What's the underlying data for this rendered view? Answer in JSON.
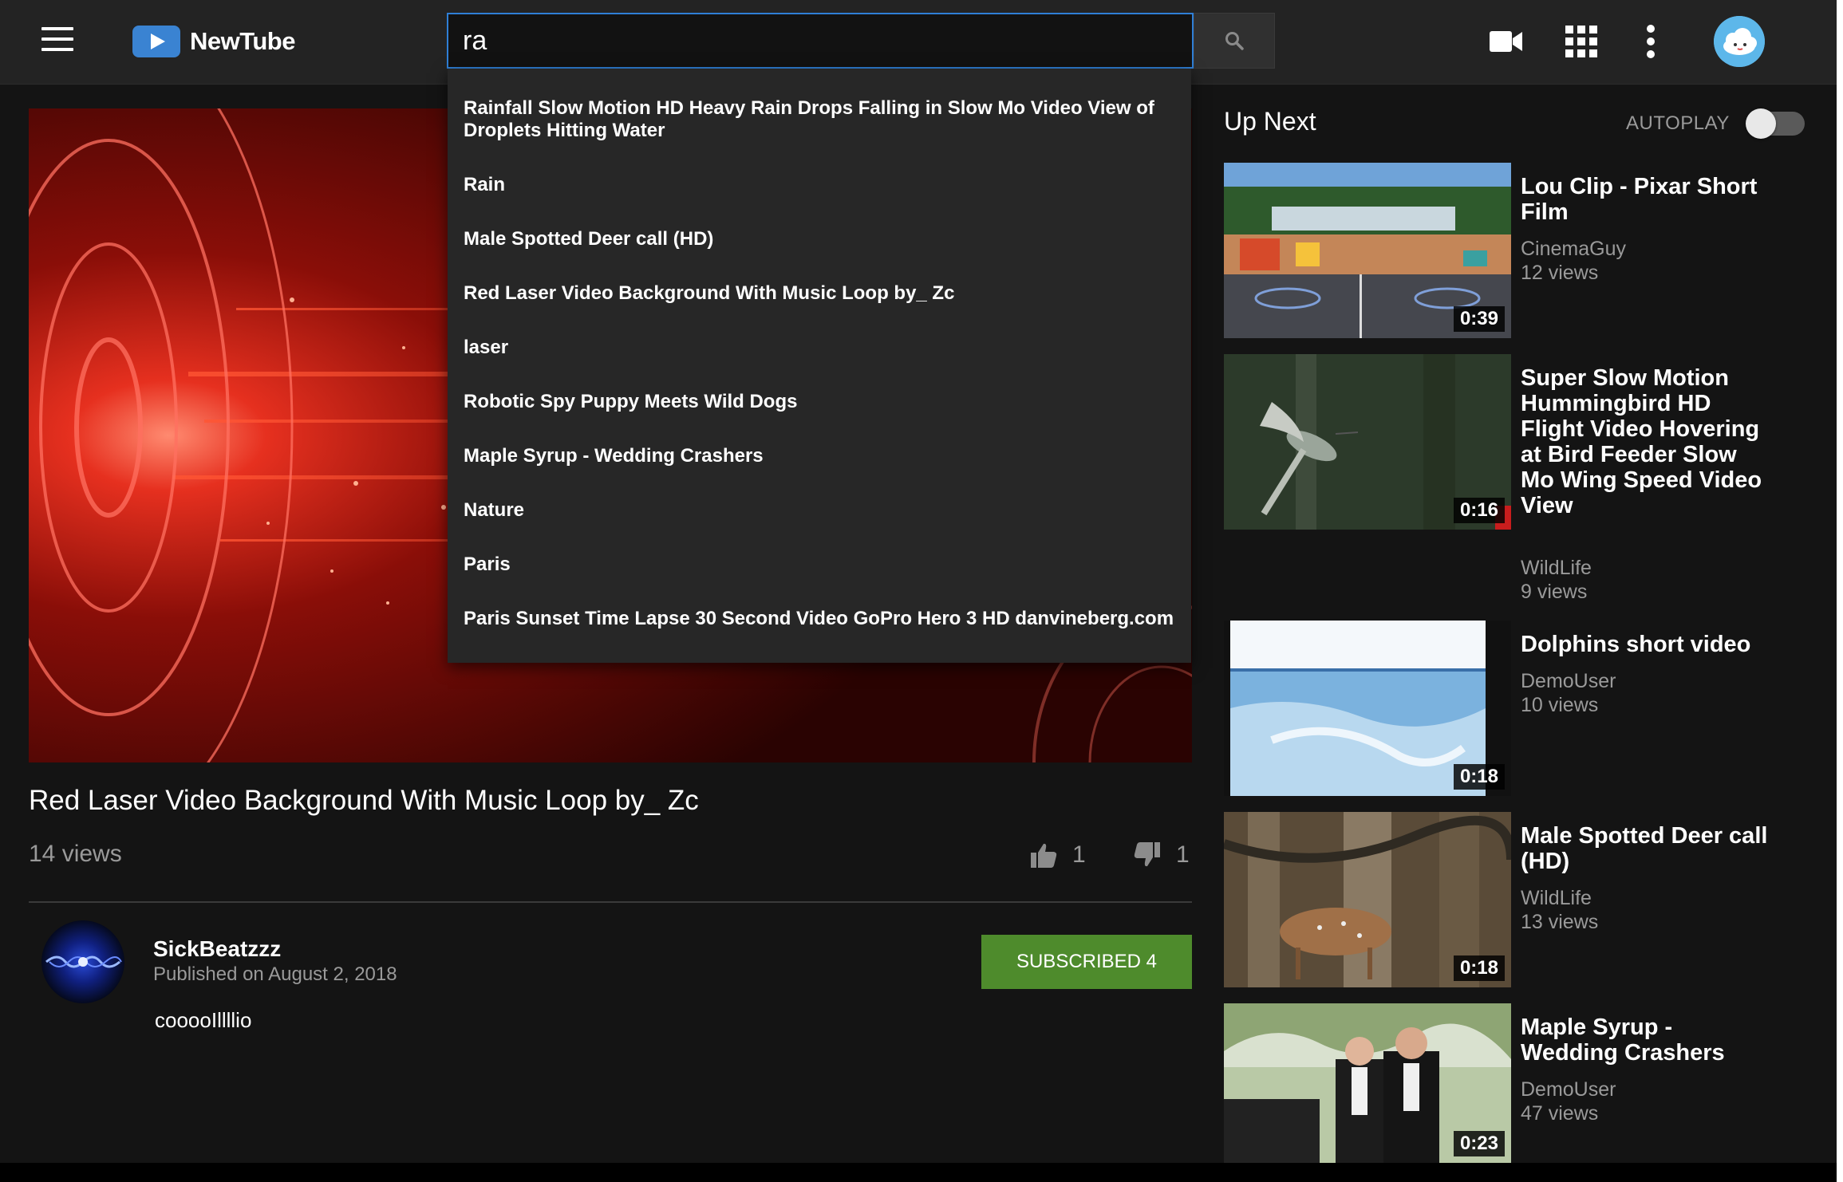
{
  "header": {
    "logo_text": "NewTube",
    "search_value": "ra"
  },
  "suggestions": [
    "Rainfall Slow Motion HD Heavy Rain Drops Falling in Slow Mo Video View of Droplets Hitting Water",
    "Rain",
    "Male Spotted Deer call (HD)",
    "Red Laser Video Background With Music Loop by_ Zc",
    "laser",
    "Robotic Spy Puppy Meets Wild Dogs",
    "Maple Syrup - Wedding Crashers",
    "Nature",
    "Paris",
    "Paris Sunset Time Lapse 30 Second Video GoPro Hero 3 HD danvineberg.com"
  ],
  "video": {
    "title": "Red Laser Video Background With Music Loop by_ Zc",
    "views": "14 views",
    "likes": "1",
    "dislikes": "1",
    "channel": "SickBeatzzz",
    "published": "Published on August 2, 2018",
    "description": "cooooIllllio",
    "subscribe_label": "SUBSCRIBED 4"
  },
  "sidebar": {
    "title": "Up Next",
    "autoplay_label": "AUTOPLAY",
    "autoplay_on": false,
    "items": [
      {
        "title": "Lou Clip - Pixar Short Film",
        "channel": "CinemaGuy",
        "views": "12 views",
        "duration": "0:39"
      },
      {
        "title": "Super Slow Motion Hummingbird HD Flight Video Hovering at Bird Feeder Slow Mo Wing Speed Video View",
        "channel": "WildLife",
        "views": "9 views",
        "duration": "0:16"
      },
      {
        "title": "Dolphins short video",
        "channel": "DemoUser",
        "views": "10 views",
        "duration": "0:18"
      },
      {
        "title": "Male Spotted Deer call (HD)",
        "channel": "WildLife",
        "views": "13 views",
        "duration": "0:18"
      },
      {
        "title": "Maple Syrup - Wedding Crashers",
        "channel": "DemoUser",
        "views": "47 views",
        "duration": "0:23"
      }
    ]
  }
}
